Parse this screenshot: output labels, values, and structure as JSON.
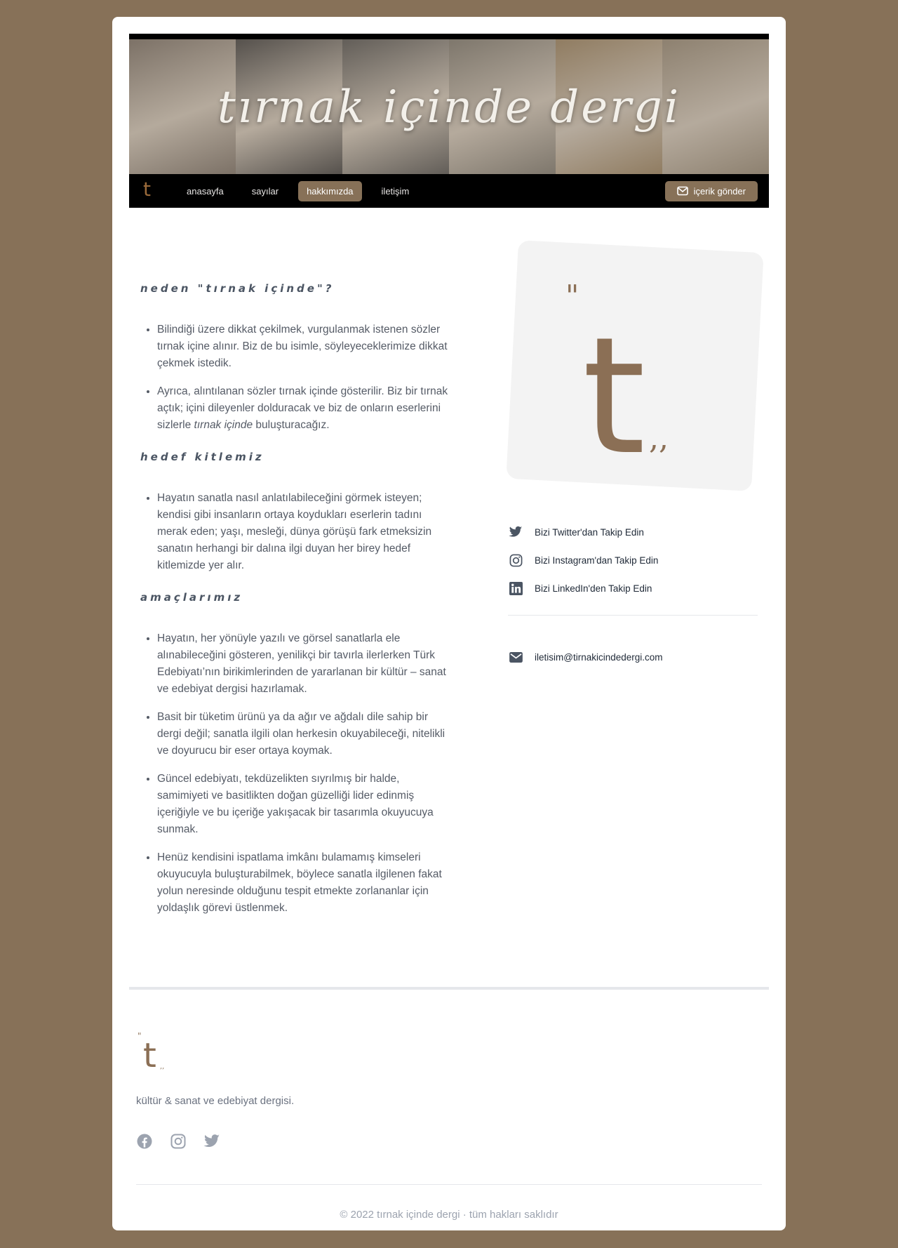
{
  "banner": {
    "title": "tırnak içinde dergi",
    "panel_colors": [
      "#8a7e72",
      "#5f5a55",
      "#6d6862",
      "#8c8478",
      "#a08a6c",
      "#9d8f7c"
    ]
  },
  "nav": {
    "logo": "t",
    "items": [
      {
        "label": "anasayfa"
      },
      {
        "label": "sayılar"
      },
      {
        "label": "hakkımızda",
        "active": true
      },
      {
        "label": "iletişim"
      }
    ],
    "cta_label": "içerik gönder"
  },
  "sections": [
    {
      "heading": "neden \"tırnak içinde\"?",
      "items": [
        "Bilindiği üzere dikkat çekilmek, vurgulanmak istenen sözler tırnak içine alınır. Biz de bu isimle, söyleyeceklerimize dikkat çekmek istedik.",
        "Ayrıca, alıntılanan sözler tırnak içinde gösterilir. Biz bir tırnak açtık; içini dileyenler dolduracak ve biz de onların eserlerini sizlerle tırnak içinde buluşturacağız."
      ]
    },
    {
      "heading": "hedef kitlemiz",
      "items": [
        "Hayatın sanatla nasıl anlatılabileceğini görmek isteyen; kendisi gibi insanların ortaya koydukları eserlerin tadını merak eden; yaşı, mesleği, dünya görüşü fark etmeksizin sanatın herhangi bir dalına ilgi duyan her birey hedef kitlemizde yer alır."
      ]
    },
    {
      "heading": "amaçlarımız",
      "items": [
        "Hayatın, her yönüyle yazılı ve görsel sanatlarla ele alınabileceğini gösteren, yenilikçi bir tavırla ilerlerken Türk Edebiyatı’nın birikimlerinden de yararlanan bir kültür – sanat ve edebiyat dergisi hazırlamak.",
        "Basit bir tüketim ürünü ya da ağır ve ağdalı dile sahip bir dergi değil; sanatla ilgili olan herkesin okuyabileceği, nitelikli ve doyurucu bir eser ortaya koymak.",
        "Güncel edebiyatı, tekdüzelikten sıyrılmış bir halde, samimiyeti ve basitlikten doğan güzelliği lider edinmiş içeriğiyle ve bu içeriğe yakışacak bir tasarımla okuyucuya sunmak.",
        "Henüz kendisini ispatlama imkânı bulamamış kimseleri okuyucuyla buluşturabilmek, böylece sanatla ilgilenen fakat yolun neresinde olduğunu tespit etmekte zorlananlar için yoldaşlık görevi üstlenmek."
      ]
    }
  ],
  "sidebar": {
    "logo_text": "t",
    "social": [
      {
        "icon": "twitter-icon",
        "label": "Bizi Twitter'dan Takip Edin"
      },
      {
        "icon": "instagram-icon",
        "label": "Bizi Instagram'dan Takip Edin"
      },
      {
        "icon": "linkedin-icon",
        "label": "Bizi LinkedIn'den Takip Edin"
      }
    ],
    "email": "iletisim@tirnakicindedergi.com"
  },
  "footer": {
    "logo_text": "t",
    "tagline": "kültür & sanat ve edebiyat dergisi.",
    "social_icons": [
      "facebook-icon",
      "instagram-icon",
      "twitter-icon"
    ],
    "copyright": "© 2022 tırnak içinde dergi · tüm hakları saklıdır"
  },
  "colors": {
    "page_background": "#877158",
    "accent": "#877158",
    "logo_brown": "#8b6f55"
  }
}
